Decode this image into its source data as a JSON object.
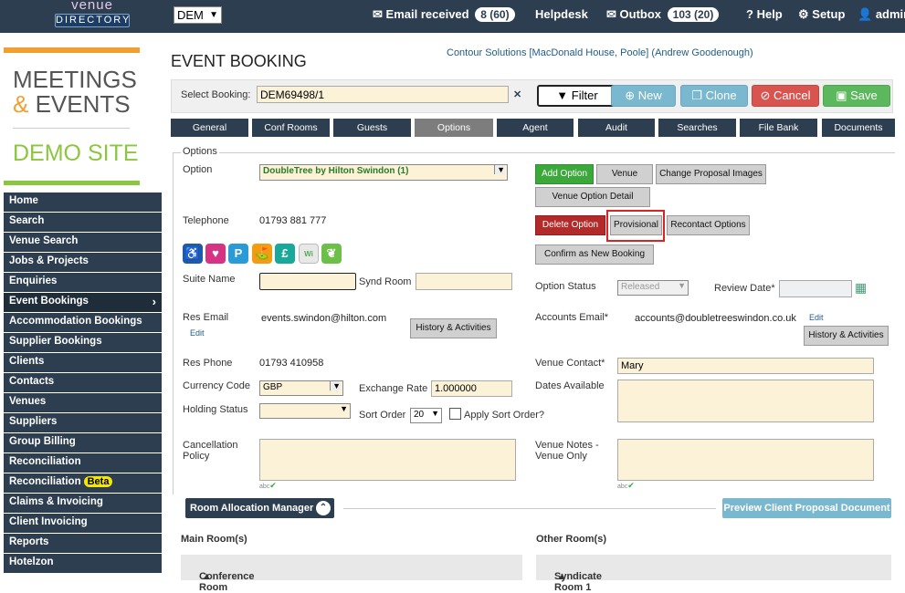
{
  "topbar": {
    "logo_line1": "venue",
    "logo_line2": "DIRECTORY",
    "company_select": "DEM",
    "email_label": "Email received",
    "email_count": "8 (60)",
    "helpdesk": "Helpdesk",
    "outbox_label": "Outbox",
    "outbox_count": "103 (20)",
    "help": "Help",
    "setup": "Setup",
    "admin": "admin"
  },
  "brand": {
    "line1": "MEETINGS",
    "amp": "&",
    "line2": "EVENTS",
    "line3": "DEMO SITE"
  },
  "nav": {
    "items": [
      "Home",
      "Search",
      "Venue Search",
      "Jobs & Projects",
      "Enquiries",
      "Event Bookings",
      "Accommodation Bookings",
      "Supplier Bookings",
      "Clients",
      "Contacts",
      "Venues",
      "Suppliers",
      "Group Billing",
      "Reconciliation",
      "Reconciliation",
      "Claims & Invoicing",
      "Client Invoicing",
      "Reports",
      "Hotelzon"
    ],
    "beta": "Beta"
  },
  "page": {
    "title": "EVENT BOOKING",
    "company": "Contour Solutions [MacDonald House, Poole] (Andrew Goodenough)",
    "select_booking_label": "Select Booking:",
    "select_booking_value": "DEM69498/1",
    "clear_x": "✕"
  },
  "toolbar": {
    "filter": "Filter",
    "new": "New",
    "clone": "Clone",
    "cancel": "Cancel",
    "save": "Save"
  },
  "tabs": [
    "General",
    "Conf Rooms",
    "Guests",
    "Options",
    "Agent",
    "Audit",
    "Searches",
    "File Bank",
    "Documents"
  ],
  "options": {
    "legend": "Options",
    "option_label": "Option",
    "option_value": "DoubleTree by Hilton Swindon (1)",
    "add_option": "Add Option",
    "venue": "Venue",
    "change_images": "Change Proposal Images",
    "venue_option_detail": "Venue Option Detail",
    "telephone_label": "Telephone",
    "telephone_value": "01793 881 777",
    "delete_option": "Delete Option",
    "provisional": "Provisional",
    "recontact_options": "Recontact Options",
    "confirm_new_booking": "Confirm as New Booking",
    "suite_name_label": "Suite Name",
    "synd_room_label": "Synd Room",
    "option_status_label": "Option Status",
    "option_status_value": "Released",
    "review_date_label": "Review Date*",
    "res_email_label": "Res Email",
    "res_email_value": "events.swindon@hilton.com",
    "edit": "Edit",
    "history_activities": "History & Activities",
    "accounts_email_label": "Accounts Email*",
    "accounts_email_value": "accounts@doubletreeswindon.co.uk",
    "res_phone_label": "Res Phone",
    "res_phone_value": "01793 410958",
    "venue_contact_label": "Venue Contact*",
    "venue_contact_value": "Mary",
    "currency_code_label": "Currency Code",
    "currency_code_value": "GBP",
    "exchange_rate_label": "Exchange Rate",
    "exchange_rate_value": "1.000000",
    "dates_available_label": "Dates Available",
    "holding_status_label": "Holding Status",
    "sort_order_label": "Sort Order",
    "sort_order_value": "20",
    "apply_sort_order": "Apply Sort Order?",
    "cancellation_policy_label1": "Cancellation",
    "cancellation_policy_label2": "Policy",
    "venue_notes_label1": "Venue Notes -",
    "venue_notes_label2": "Venue Only",
    "abc": "abc"
  },
  "rooms": {
    "manager": "Room Allocation Manager",
    "preview": "Preview Client Proposal Document",
    "main_rooms": "Main Room(s)",
    "other_rooms": "Other Room(s)",
    "conference_room": "Conference Room",
    "syndicate_room": "Syndicate Room 1"
  }
}
